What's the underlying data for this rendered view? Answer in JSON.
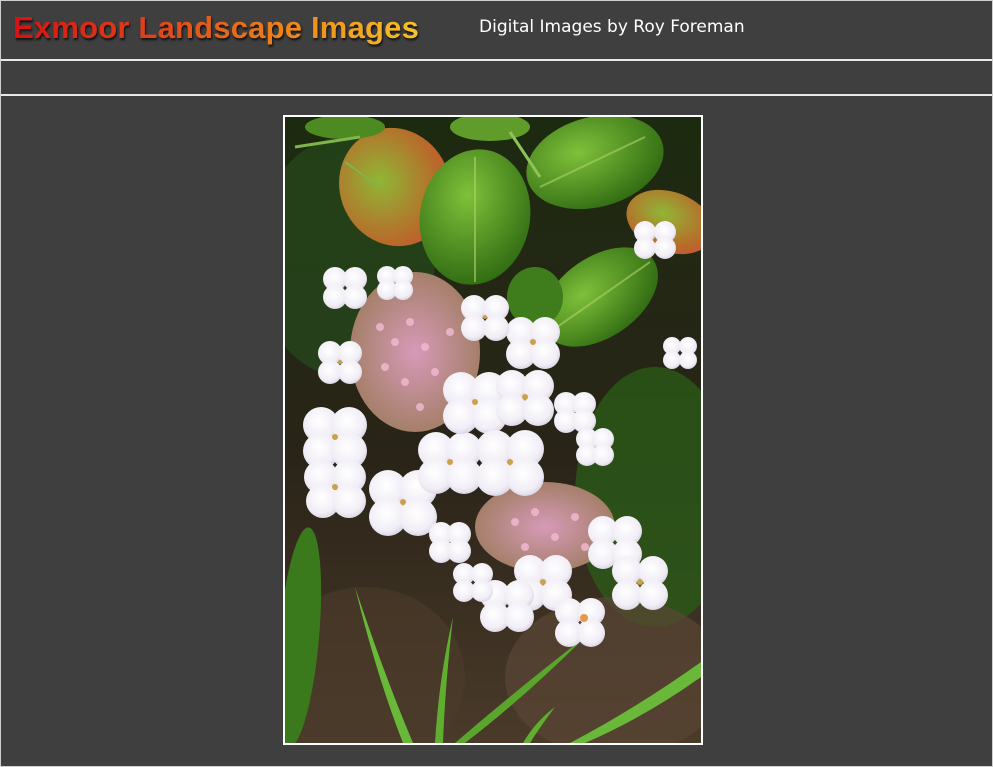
{
  "header": {
    "title": "Exmoor Landscape Images",
    "subtitle": "Digital Images by Roy Foreman"
  },
  "colors": {
    "background": "#3f3f3f",
    "rule": "#e8e8e8",
    "title_gradient": [
      "#d61212",
      "#ee8a1a",
      "#f6c22a"
    ],
    "subtitle": "#ffffff"
  },
  "photo": {
    "subject": "hydrangea-flower-photo"
  }
}
